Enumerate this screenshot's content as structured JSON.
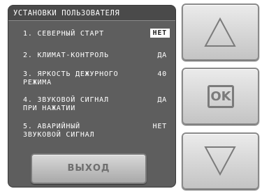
{
  "panel": {
    "title": "УСТАНОВКИ ПОЛЬЗОВАТЕЛЯ",
    "items": [
      {
        "label": "1. СЕВЕРНЫЙ СТАРТ",
        "label2": "",
        "value": "НЕТ",
        "selected": true
      },
      {
        "label": "2. КЛИМАТ-КОНТРОЛЬ",
        "label2": "",
        "value": "ДА",
        "selected": false
      },
      {
        "label": "3. ЯРКОСТЬ ДЕЖУРНОГО",
        "label2": "РЕЖИМА",
        "value": "40",
        "selected": false
      },
      {
        "label": "4. ЗВУКОВОЙ СИГНАЛ",
        "label2": "ПРИ НАЖАТИИ",
        "value": "ДА",
        "selected": false
      },
      {
        "label": "5. АВАРИЙНЫЙ",
        "label2": "ЗВУКОВОЙ СИГНАЛ",
        "value": "НЕТ",
        "selected": false
      }
    ],
    "exit_label": "ВЫХОД"
  },
  "side_buttons": {
    "up_icon": "triangle-up-icon",
    "ok_label": "OK",
    "down_icon": "triangle-down-icon"
  },
  "colors": {
    "panel_bg": "#5e5e5e",
    "selected_value_bg": "#ffffff",
    "button_face": "#d6d6d6",
    "icon_gray": "#7b7b7b"
  }
}
